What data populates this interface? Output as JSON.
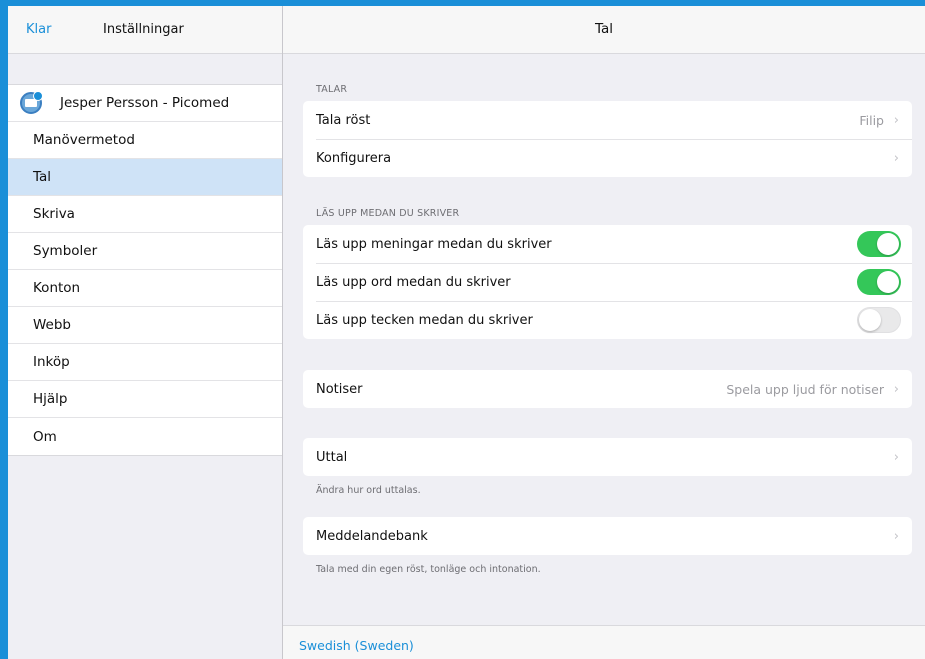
{
  "sidebar": {
    "done_label": "Klar",
    "title": "Inställningar",
    "account_name": "Jesper Persson - Picomed",
    "items": [
      {
        "label": "Manövermetod",
        "name": "sidebar-item-manovermetod"
      },
      {
        "label": "Tal",
        "name": "sidebar-item-tal",
        "selected": true
      },
      {
        "label": "Skriva",
        "name": "sidebar-item-skriva"
      },
      {
        "label": "Symboler",
        "name": "sidebar-item-symboler"
      },
      {
        "label": "Konton",
        "name": "sidebar-item-konton"
      },
      {
        "label": "Webb",
        "name": "sidebar-item-webb"
      },
      {
        "label": "Inköp",
        "name": "sidebar-item-inkop"
      },
      {
        "label": "Hjälp",
        "name": "sidebar-item-hjalp"
      },
      {
        "label": "Om",
        "name": "sidebar-item-om"
      }
    ]
  },
  "main": {
    "title": "Tal",
    "talar": {
      "header": "TALAR",
      "voice_label": "Tala röst",
      "voice_value": "Filip",
      "configure_label": "Konfigurera"
    },
    "read_aloud": {
      "header": "LÄS UPP MEDAN DU SKRIVER",
      "sentences_label": "Läs upp meningar medan du skriver",
      "sentences_on": true,
      "words_label": "Läs upp ord medan du skriver",
      "words_on": true,
      "chars_label": "Läs upp tecken medan du skriver",
      "chars_on": false
    },
    "notifications": {
      "label": "Notiser",
      "value": "Spela upp ljud för notiser"
    },
    "pronunciation": {
      "label": "Uttal",
      "footnote": "Ändra hur ord uttalas."
    },
    "message_bank": {
      "label": "Meddelandebank",
      "footnote": "Tala med din egen röst, tonläge och intonation."
    },
    "language_link": "Swedish (Sweden)"
  },
  "icons": {
    "chevron": "chevron-right-icon",
    "avatar": "account-avatar-icon"
  },
  "colors": {
    "accent": "#1a8fd8",
    "toggle_on": "#34c759",
    "selected_row": "#cfe3f7"
  }
}
